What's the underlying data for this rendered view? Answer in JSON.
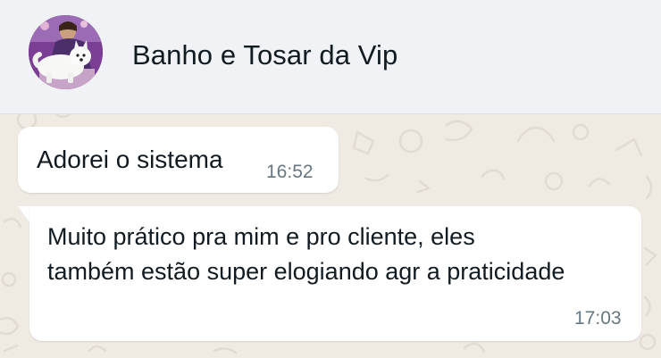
{
  "header": {
    "contact_name": "Banho e Tosar da Vip",
    "avatar_icon": "profile-photo-dog"
  },
  "messages": [
    {
      "text": "Adorei o sistema",
      "time": "16:52"
    },
    {
      "text": "Muito prático pra mim e pro cliente, eles também estão super elogiando agr a praticidade",
      "time": "17:03"
    }
  ],
  "colors": {
    "header_bg": "#f0f2f5",
    "chat_bg": "#efeae2",
    "bubble_bg": "#ffffff",
    "time_text": "#667781"
  }
}
